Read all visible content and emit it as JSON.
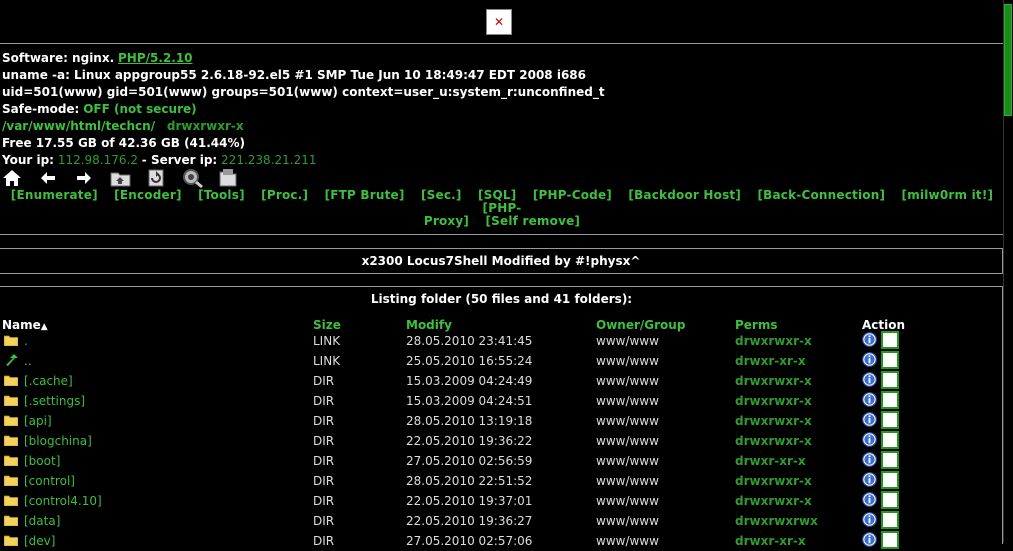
{
  "logo": {
    "glyph": "✕"
  },
  "info": {
    "software_label": "Software: nginx.",
    "software_link": "PHP/5.2.10",
    "uname": "uname -a: Linux appgroup55 2.6.18-92.el5 #1 SMP Tue Jun 10 18:49:47 EDT 2008 i686",
    "uid": "uid=501(www) gid=501(www) groups=501(www) context=user_u:system_r:unconfined_t",
    "safe_label": "Safe-mode:",
    "safe_value": "OFF (not secure)",
    "path": "/var/www/html/techcn/",
    "path_perms": "drwxrwxr-x",
    "free_space": "Free 17.55 GB of 42.36 GB (41.44%)",
    "your_ip_label": "Your ip:",
    "your_ip": "112.98.176.2",
    "server_ip_label": "- Server ip:",
    "server_ip": "221.238.21.211"
  },
  "toolbar_icons": [
    "home-icon",
    "back-arrow-icon",
    "forward-arrow-icon",
    "up-folder-icon",
    "refresh-icon",
    "search-icon",
    "buffer-icon"
  ],
  "menu": {
    "line1": [
      "[Enumerate]",
      "[Encoder]",
      "[Tools]",
      "[Proc.]",
      "[FTP Brute]",
      "[Sec.]",
      "[SQL]",
      "[PHP-Code]",
      "[Backdoor Host]",
      "[Back-Connection]",
      "[milw0rm it!]",
      "[PHP-"
    ],
    "line2": [
      "Proxy]",
      "[Self remove]"
    ]
  },
  "title_banner": "x2300 Locus7Shell Modified by #!physx^",
  "listing_title": "Listing folder (50 files and 41 folders):",
  "columns": {
    "name": "Name",
    "sort_arrow": "▲",
    "size": "Size",
    "modify": "Modify",
    "owner": "Owner/Group",
    "perms": "Perms",
    "action": "Action"
  },
  "rows": [
    {
      "name": ".",
      "size": "LINK",
      "modify": "28.05.2010 23:41:45",
      "owner": "www/www",
      "perms": "drwxrwxr-x",
      "icon": "folder-icon"
    },
    {
      "name": "..",
      "size": "LINK",
      "modify": "25.05.2010 16:55:24",
      "owner": "www/www",
      "perms": "drwxr-xr-x",
      "icon": "up-arrow-icon"
    },
    {
      "name": "[.cache]",
      "size": "DIR",
      "modify": "15.03.2009 04:24:49",
      "owner": "www/www",
      "perms": "drwxrwxr-x",
      "icon": "folder-icon"
    },
    {
      "name": "[.settings]",
      "size": "DIR",
      "modify": "15.03.2009 04:24:51",
      "owner": "www/www",
      "perms": "drwxrwxr-x",
      "icon": "folder-icon"
    },
    {
      "name": "[api]",
      "size": "DIR",
      "modify": "28.05.2010 13:19:18",
      "owner": "www/www",
      "perms": "drwxrwxr-x",
      "icon": "folder-icon"
    },
    {
      "name": "[blogchina]",
      "size": "DIR",
      "modify": "22.05.2010 19:36:22",
      "owner": "www/www",
      "perms": "drwxrwxr-x",
      "icon": "folder-icon"
    },
    {
      "name": "[boot]",
      "size": "DIR",
      "modify": "27.05.2010 02:56:59",
      "owner": "www/www",
      "perms": "drwxr-xr-x",
      "icon": "folder-icon"
    },
    {
      "name": "[control]",
      "size": "DIR",
      "modify": "28.05.2010 22:51:52",
      "owner": "www/www",
      "perms": "drwxrwxr-x",
      "icon": "folder-icon"
    },
    {
      "name": "[control4.10]",
      "size": "DIR",
      "modify": "22.05.2010 19:37:01",
      "owner": "www/www",
      "perms": "drwxrwxr-x",
      "icon": "folder-icon"
    },
    {
      "name": "[data]",
      "size": "DIR",
      "modify": "22.05.2010 19:36:27",
      "owner": "www/www",
      "perms": "drwxrwxrwx",
      "icon": "folder-icon"
    },
    {
      "name": "[dev]",
      "size": "DIR",
      "modify": "27.05.2010 02:57:06",
      "owner": "www/www",
      "perms": "drwxr-xr-x",
      "icon": "folder-icon"
    }
  ]
}
